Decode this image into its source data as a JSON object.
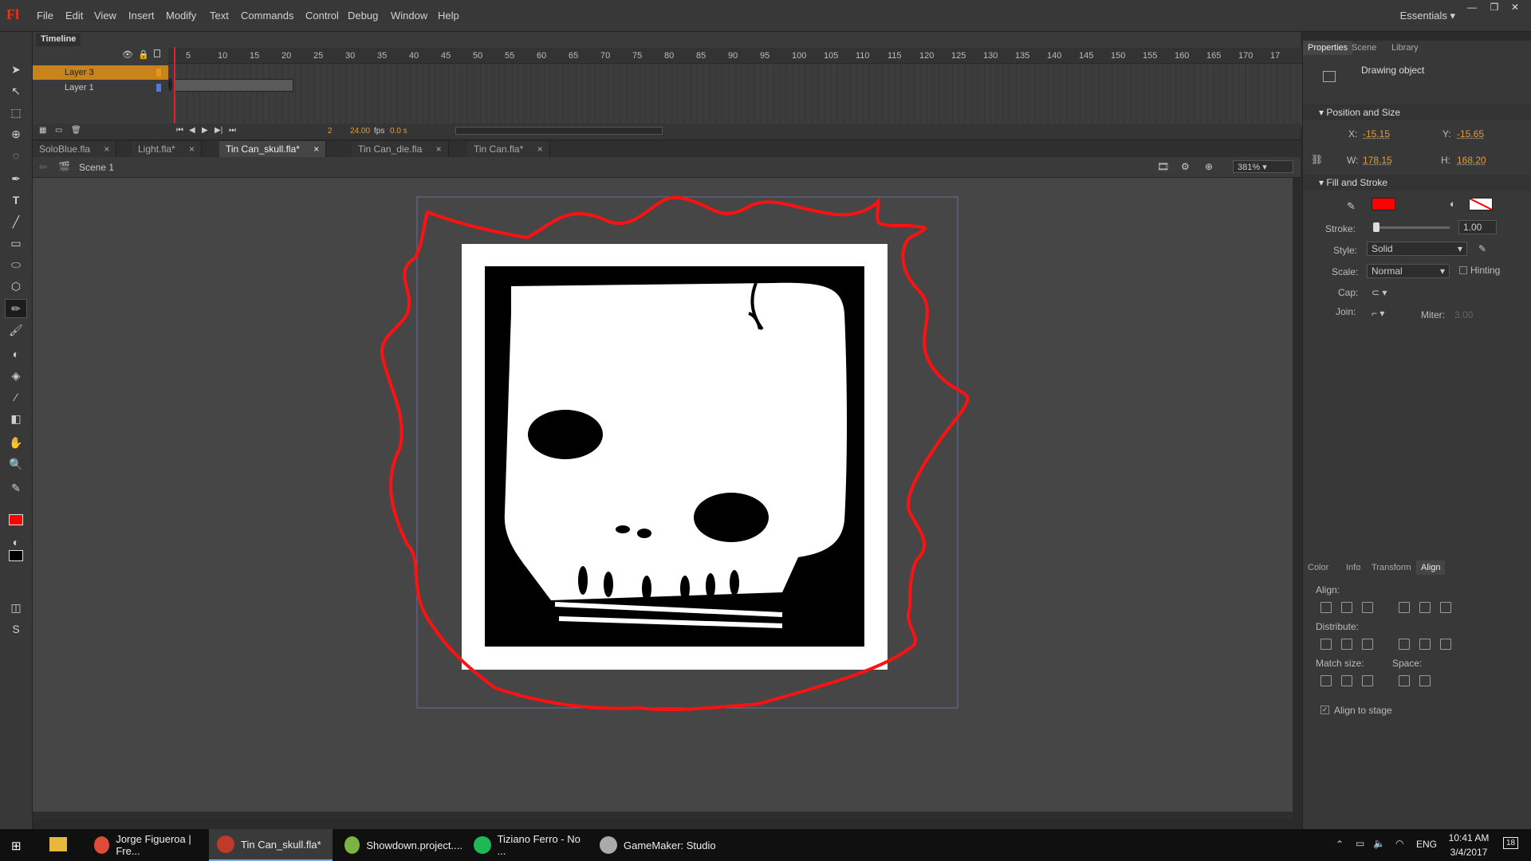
{
  "app": {
    "logo": "Fl",
    "workspace": "Essentials"
  },
  "menu": [
    "File",
    "Edit",
    "View",
    "Insert",
    "Modify",
    "Text",
    "Commands",
    "Control",
    "Debug",
    "Window",
    "Help"
  ],
  "timeline": {
    "tab": "Timeline",
    "ticks": [
      "5",
      "10",
      "15",
      "20",
      "25",
      "30",
      "35",
      "40",
      "45",
      "50",
      "55",
      "60",
      "65",
      "70",
      "75",
      "80",
      "85",
      "90",
      "95",
      "100",
      "105",
      "110",
      "115",
      "120",
      "125",
      "130",
      "135",
      "140",
      "145",
      "150",
      "155",
      "160",
      "165",
      "170",
      "17"
    ],
    "layers": [
      {
        "name": "Layer 3",
        "color": "#e8951c",
        "selected": true
      },
      {
        "name": "Layer 1",
        "color": "#4f7bd9",
        "selected": false
      }
    ],
    "frame": "2",
    "fps": "24.00",
    "fps_unit": "fps",
    "time": "0.0 s"
  },
  "doc_tabs": [
    {
      "label": "SoloBlue.fla",
      "active": false
    },
    {
      "label": "Light.fla*",
      "active": false
    },
    {
      "label": "Tin Can_skull.fla*",
      "active": true
    },
    {
      "label": "Tin Can_die.fla",
      "active": false
    },
    {
      "label": "Tin Can.fla*",
      "active": false
    }
  ],
  "editbar": {
    "scene": "Scene 1",
    "zoom": "381%"
  },
  "panel": {
    "tabs": [
      "Properties",
      "Scene",
      "Library"
    ],
    "object_type": "Drawing object",
    "position": {
      "title": "Position and Size",
      "x_label": "X:",
      "x": "-15.15",
      "y_label": "Y:",
      "y": "-15.65",
      "w_label": "W:",
      "w": "178.15",
      "h_label": "H:",
      "h": "168.20"
    },
    "fill": {
      "title": "Fill and Stroke",
      "stroke_label": "Stroke:",
      "stroke_value": "1.00",
      "style_label": "Style:",
      "style": "Solid",
      "scale_label": "Scale:",
      "scale": "Normal",
      "hinting": "Hinting",
      "cap_label": "Cap:",
      "join_label": "Join:",
      "miter_label": "Miter:",
      "miter": "3.00",
      "stroke_color": "#ff0000"
    },
    "lower_tabs": [
      "Color",
      "Info",
      "Transform",
      "Align"
    ],
    "align": {
      "align_label": "Align:",
      "distribute_label": "Distribute:",
      "match_label": "Match size:",
      "space_label": "Space:",
      "to_stage": "Align to stage"
    }
  },
  "taskbar": {
    "items": [
      {
        "label": "Jorge Figueroa | Fre...",
        "icon": "chrome-icon",
        "color": "#dd4b39"
      },
      {
        "label": "Tin Can_skull.fla*",
        "icon": "flash-icon",
        "color": "#c0392b"
      },
      {
        "label": "Showdown.project....",
        "icon": "gamemaker-icon",
        "color": "#7cb342"
      },
      {
        "label": "Tiziano Ferro - No ...",
        "icon": "spotify-icon",
        "color": "#1db954"
      },
      {
        "label": "GameMaker: Studio",
        "icon": "gamemaker-icon",
        "color": "#aaaaaa"
      }
    ],
    "lang": "ENG",
    "time": "10:41 AM",
    "date": "3/4/2017",
    "notif": "18"
  }
}
